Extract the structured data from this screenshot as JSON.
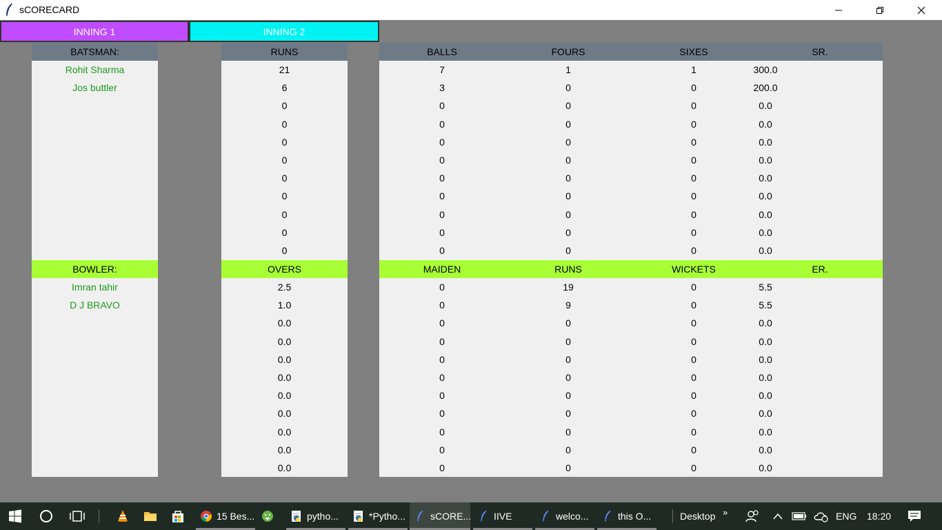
{
  "window": {
    "title": "sCORECARD"
  },
  "tabs": [
    {
      "label": "INNING 1",
      "color": "#c04cff"
    },
    {
      "label": "INNING 2",
      "color": "#00f2f2"
    }
  ],
  "batting": {
    "headers": {
      "name": "BATSMAN:",
      "runs": "RUNS",
      "balls": "BALLS",
      "fours": "FOURS",
      "sixes": "SIXES",
      "sr": "SR."
    },
    "rows": [
      {
        "name": "Rohit Sharma",
        "runs": "21",
        "balls": "7",
        "fours": "1",
        "sixes": "1",
        "sr": "300.0"
      },
      {
        "name": "Jos buttler",
        "runs": "6",
        "balls": "3",
        "fours": "0",
        "sixes": "0",
        "sr": "200.0"
      },
      {
        "name": "",
        "runs": "0",
        "balls": "0",
        "fours": "0",
        "sixes": "0",
        "sr": "0.0"
      },
      {
        "name": "",
        "runs": "0",
        "balls": "0",
        "fours": "0",
        "sixes": "0",
        "sr": "0.0"
      },
      {
        "name": "",
        "runs": "0",
        "balls": "0",
        "fours": "0",
        "sixes": "0",
        "sr": "0.0"
      },
      {
        "name": "",
        "runs": "0",
        "balls": "0",
        "fours": "0",
        "sixes": "0",
        "sr": "0.0"
      },
      {
        "name": "",
        "runs": "0",
        "balls": "0",
        "fours": "0",
        "sixes": "0",
        "sr": "0.0"
      },
      {
        "name": "",
        "runs": "0",
        "balls": "0",
        "fours": "0",
        "sixes": "0",
        "sr": "0.0"
      },
      {
        "name": "",
        "runs": "0",
        "balls": "0",
        "fours": "0",
        "sixes": "0",
        "sr": "0.0"
      },
      {
        "name": "",
        "runs": "0",
        "balls": "0",
        "fours": "0",
        "sixes": "0",
        "sr": "0.0"
      },
      {
        "name": "",
        "runs": "0",
        "balls": "0",
        "fours": "0",
        "sixes": "0",
        "sr": "0.0"
      }
    ]
  },
  "bowling": {
    "headers": {
      "name": "BOWLER:",
      "overs": "OVERS",
      "maiden": "MAIDEN",
      "runs": "RUNS",
      "wickets": "WICKETS",
      "er": "ER."
    },
    "rows": [
      {
        "name": "Imran tahir",
        "overs": "2.5",
        "maiden": "0",
        "runs": "19",
        "wickets": "0",
        "er": "5.5"
      },
      {
        "name": "D J BRAVO",
        "overs": "1.0",
        "maiden": "0",
        "runs": "9",
        "wickets": "0",
        "er": "5.5"
      },
      {
        "name": "",
        "overs": "0.0",
        "maiden": "0",
        "runs": "0",
        "wickets": "0",
        "er": "0.0"
      },
      {
        "name": "",
        "overs": "0.0",
        "maiden": "0",
        "runs": "0",
        "wickets": "0",
        "er": "0.0"
      },
      {
        "name": "",
        "overs": "0.0",
        "maiden": "0",
        "runs": "0",
        "wickets": "0",
        "er": "0.0"
      },
      {
        "name": "",
        "overs": "0.0",
        "maiden": "0",
        "runs": "0",
        "wickets": "0",
        "er": "0.0"
      },
      {
        "name": "",
        "overs": "0.0",
        "maiden": "0",
        "runs": "0",
        "wickets": "0",
        "er": "0.0"
      },
      {
        "name": "",
        "overs": "0.0",
        "maiden": "0",
        "runs": "0",
        "wickets": "0",
        "er": "0.0"
      },
      {
        "name": "",
        "overs": "0.0",
        "maiden": "0",
        "runs": "0",
        "wickets": "0",
        "er": "0.0"
      },
      {
        "name": "",
        "overs": "0.0",
        "maiden": "0",
        "runs": "0",
        "wickets": "0",
        "er": "0.0"
      },
      {
        "name": "",
        "overs": "0.0",
        "maiden": "0",
        "runs": "0",
        "wickets": "0",
        "er": "0.0"
      }
    ]
  },
  "colors": {
    "name_text": "#1e9a1e",
    "batting_header": "#6e7b87",
    "bowling_header": "#a9ff36"
  },
  "taskbar": {
    "tasks": [
      {
        "label": "15 Bes...",
        "icon": "chrome-icon"
      },
      {
        "label": "",
        "icon": "android-studio-icon"
      },
      {
        "label": "pytho...",
        "icon": "python-idle-icon"
      },
      {
        "label": "*Pytho...",
        "icon": "python-idle-icon"
      },
      {
        "label": "sCORE...",
        "icon": "feather-icon"
      },
      {
        "label": "IIVE",
        "icon": "feather-icon"
      },
      {
        "label": "welco...",
        "icon": "feather-icon"
      },
      {
        "label": "this O...",
        "icon": "feather-icon"
      }
    ],
    "desktop_label": "Desktop",
    "overflow": "»",
    "language": "ENG",
    "clock": "18:20"
  }
}
